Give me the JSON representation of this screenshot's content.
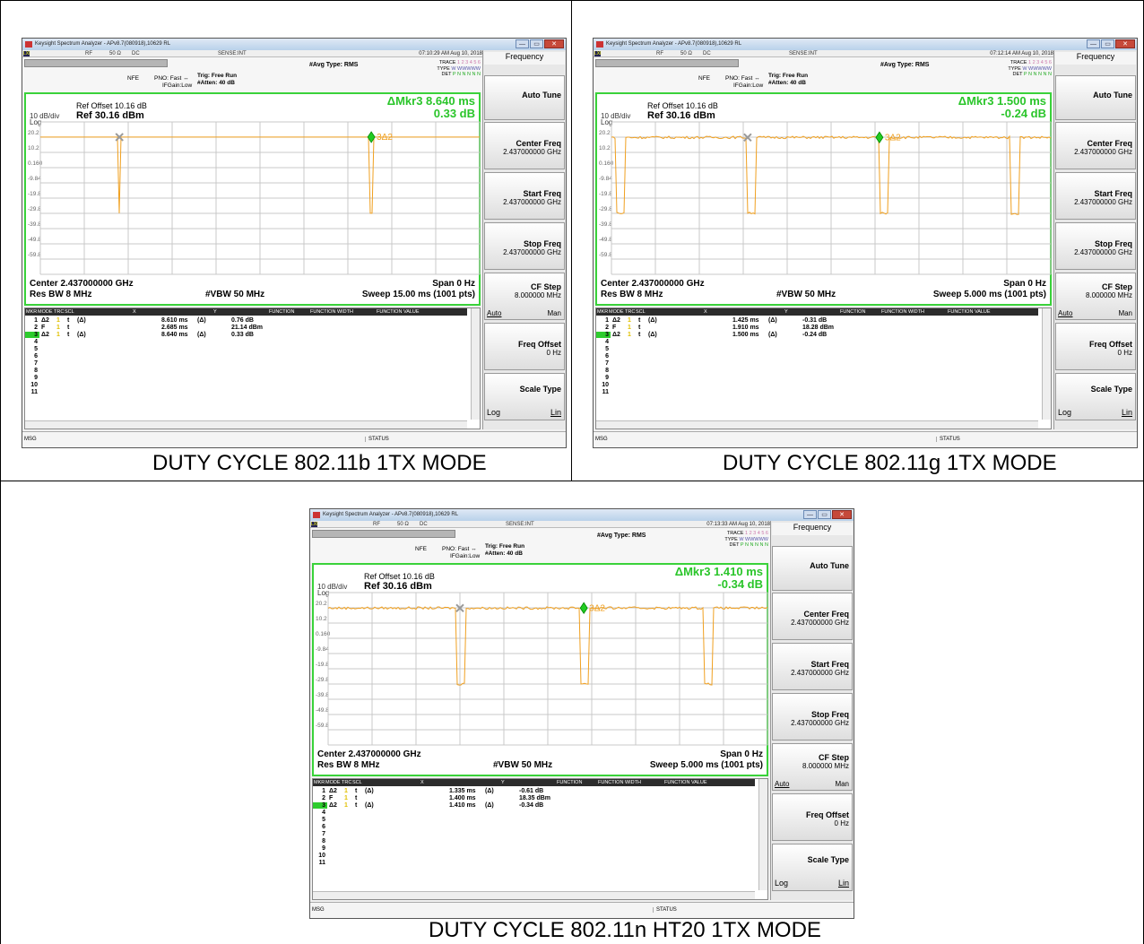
{
  "captions": [
    "DUTY CYCLE 802.11b 1TX MODE",
    "DUTY CYCLE 802.11g 1TX MODE",
    "DUTY CYCLE 802.11n HT20 1TX MODE"
  ],
  "common": {
    "title": "Keysight Spectrum Analyzer - APv8.7(080918),10629 RL",
    "win_min": "—",
    "win_max": "▭",
    "win_close": "✕",
    "rf": "RF",
    "ohm": "50 Ω",
    "dc": "DC",
    "sense": "SENSE:INT",
    "avg_type": "#Avg Type: RMS",
    "trace_label": "TRACE",
    "trace_vals": "1 2 3 4 5 6",
    "type_label": "TYPE",
    "type_vals": "W WWWWW",
    "det_label": "DET",
    "det_vals": "P N N N N N",
    "nfe": "NFE",
    "pno": "PNO: Fast ↔",
    "ifgain": "IFGain:Low",
    "trig": "Trig: Free Run",
    "atten": "#Atten: 40 dB",
    "ref_offset": "Ref Offset 10.16 dB",
    "ref_level": "Ref 30.16 dBm",
    "db_div": "10 dB/div",
    "log": "Log",
    "y_labels": [
      "20.2",
      "10.2",
      "0.160",
      "-9.84",
      "-19.8",
      "-29.8",
      "-39.8",
      "-49.8",
      "-59.8"
    ],
    "center": "Center 2.437000000 GHz",
    "span": "Span 0 Hz",
    "rbw": "Res BW 8 MHz",
    "vbw": "#VBW 50 MHz",
    "table_headers": [
      "MKR",
      "MODE",
      "TRC",
      "SCL",
      "X",
      "Y",
      "FUNCTION",
      "FUNCTION WIDTH",
      "FUNCTION VALUE"
    ],
    "row_numbers": [
      "1",
      "2",
      "3",
      "4",
      "5",
      "6",
      "7",
      "8",
      "9",
      "10",
      "11"
    ],
    "msg": "MSG",
    "status": "STATUS",
    "softkeys": {
      "menu": "Frequency",
      "auto_tune": "Auto Tune",
      "center_freq": "Center Freq",
      "center_val": "2.437000000 GHz",
      "start_freq": "Start Freq",
      "start_val": "2.437000000 GHz",
      "stop_freq": "Stop Freq",
      "stop_val": "2.437000000 GHz",
      "cf_step": "CF Step",
      "cf_val": "8.000000 MHz",
      "auto": "Auto",
      "man": "Man",
      "freq_offset": "Freq Offset",
      "offset_val": "0 Hz",
      "scale_type": "Scale Type",
      "log": "Log",
      "lin": "Lin"
    }
  },
  "screens": [
    {
      "time": "07:10:29 AM Aug 10, 2018",
      "delta_line1": "ΔMkr3 8.640 ms",
      "delta_line2": "0.33 dB",
      "sweep": "Sweep  15.00 ms (1001 pts)",
      "marker_label": "3Δ2",
      "markers": [
        {
          "mode": "Δ2",
          "trc": "1",
          "scl": "t",
          "xmod": "(Δ)",
          "x": "8.610 ms",
          "ymod": "(Δ)",
          "y": "0.76 dB"
        },
        {
          "mode": "F",
          "trc": "1",
          "scl": "t",
          "xmod": "",
          "x": "2.685 ms",
          "ymod": "",
          "y": "21.14 dBm"
        },
        {
          "mode": "Δ2",
          "trc": "1",
          "scl": "t",
          "xmod": "(Δ)",
          "x": "8.640 ms",
          "ymod": "(Δ)",
          "y": "0.33 dB"
        }
      ],
      "trace": {
        "level_db": 20.2,
        "sweep_ms": 15.0,
        "dips_ms": [
          2.7,
          11.3
        ],
        "dip_level_db": -29.8,
        "dip_width_ms": 0.02,
        "noisy": false
      },
      "marker_pos_ms": {
        "x_ref": 2.7,
        "diamond": 11.3
      }
    },
    {
      "time": "07:12:14 AM Aug 10, 2018",
      "delta_line1": "ΔMkr3 1.500 ms",
      "delta_line2": "-0.24 dB",
      "sweep": "Sweep  5.000 ms (1001 pts)",
      "marker_label": "3Δ2",
      "markers": [
        {
          "mode": "Δ2",
          "trc": "1",
          "scl": "t",
          "xmod": "(Δ)",
          "x": "1.425 ms",
          "ymod": "(Δ)",
          "y": "-0.31 dB"
        },
        {
          "mode": "F",
          "trc": "1",
          "scl": "t",
          "xmod": "",
          "x": "1.910 ms",
          "ymod": "",
          "y": "18.28 dBm"
        },
        {
          "mode": "Δ2",
          "trc": "1",
          "scl": "t",
          "xmod": "(Δ)",
          "x": "1.500 ms",
          "ymod": "(Δ)",
          "y": "-0.24 dB"
        }
      ],
      "trace": {
        "level_db": 20.0,
        "sweep_ms": 5.0,
        "dips_ms": [
          0.1,
          1.6,
          3.1,
          4.6
        ],
        "dip_level_db": -29.8,
        "dip_width_ms": 0.05,
        "noisy": true
      },
      "marker_pos_ms": {
        "x_ref": 1.55,
        "diamond": 3.05
      }
    },
    {
      "time": "07:13:33 AM Aug 10, 2018",
      "delta_line1": "ΔMkr3 1.410 ms",
      "delta_line2": "-0.34 dB",
      "sweep": "Sweep  5.000 ms (1001 pts)",
      "marker_label": "3Δ2",
      "markers": [
        {
          "mode": "Δ2",
          "trc": "1",
          "scl": "t",
          "xmod": "(Δ)",
          "x": "1.335 ms",
          "ymod": "(Δ)",
          "y": "-0.61 dB"
        },
        {
          "mode": "F",
          "trc": "1",
          "scl": "t",
          "xmod": "",
          "x": "1.400 ms",
          "ymod": "",
          "y": "18.35 dBm"
        },
        {
          "mode": "Δ2",
          "trc": "1",
          "scl": "t",
          "xmod": "(Δ)",
          "x": "1.410 ms",
          "ymod": "(Δ)",
          "y": "-0.34 dB"
        }
      ],
      "trace": {
        "level_db": 20.0,
        "sweep_ms": 5.0,
        "dips_ms": [
          1.51,
          2.92,
          4.33
        ],
        "dip_level_db": -29.8,
        "dip_width_ms": 0.05,
        "noisy": true
      },
      "marker_pos_ms": {
        "x_ref": 1.5,
        "diamond": 2.91
      }
    }
  ]
}
